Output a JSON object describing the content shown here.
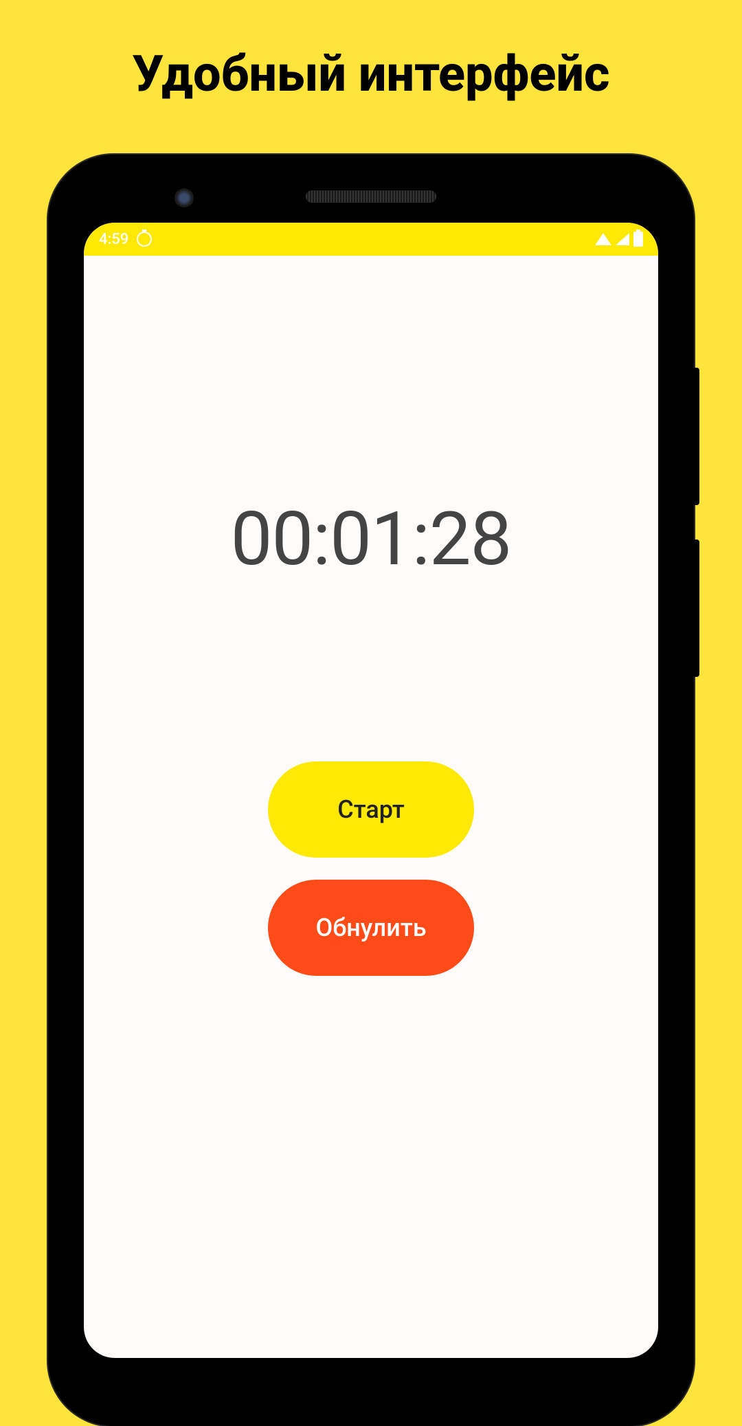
{
  "page": {
    "title": "Удобный интерфейс"
  },
  "statusBar": {
    "time": "4:59"
  },
  "timer": {
    "display": "00:01:28"
  },
  "buttons": {
    "start": "Старт",
    "reset": "Обнулить"
  }
}
